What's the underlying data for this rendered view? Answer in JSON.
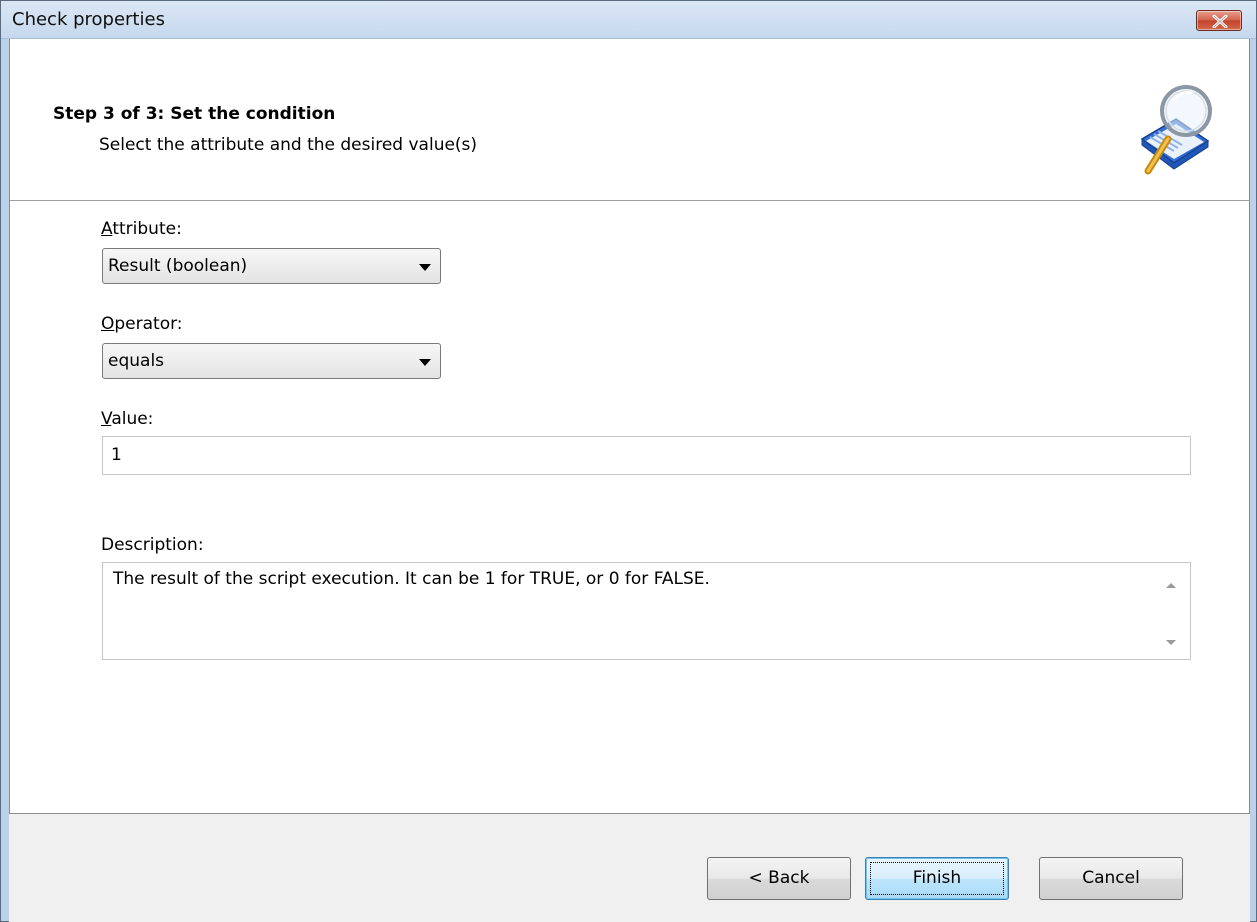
{
  "window": {
    "title": "Check properties"
  },
  "header": {
    "step_title": "Step 3 of 3: Set the condition",
    "step_subtitle": "Select the attribute and the desired value(s)",
    "icon": "search-book-icon"
  },
  "form": {
    "attribute": {
      "label_accel": "A",
      "label_rest": "ttribute:",
      "selected": "Result (boolean)"
    },
    "operator": {
      "label_accel": "O",
      "label_rest": "perator:",
      "selected": "equals"
    },
    "value": {
      "label_accel": "V",
      "label_rest": "alue:",
      "current": "1"
    },
    "description": {
      "label": "Description:",
      "text": "The result of the script execution. It can be 1 for TRUE, or 0 for FALSE."
    }
  },
  "buttons": {
    "back": "< Back",
    "finish": "Finish",
    "cancel": "Cancel"
  }
}
